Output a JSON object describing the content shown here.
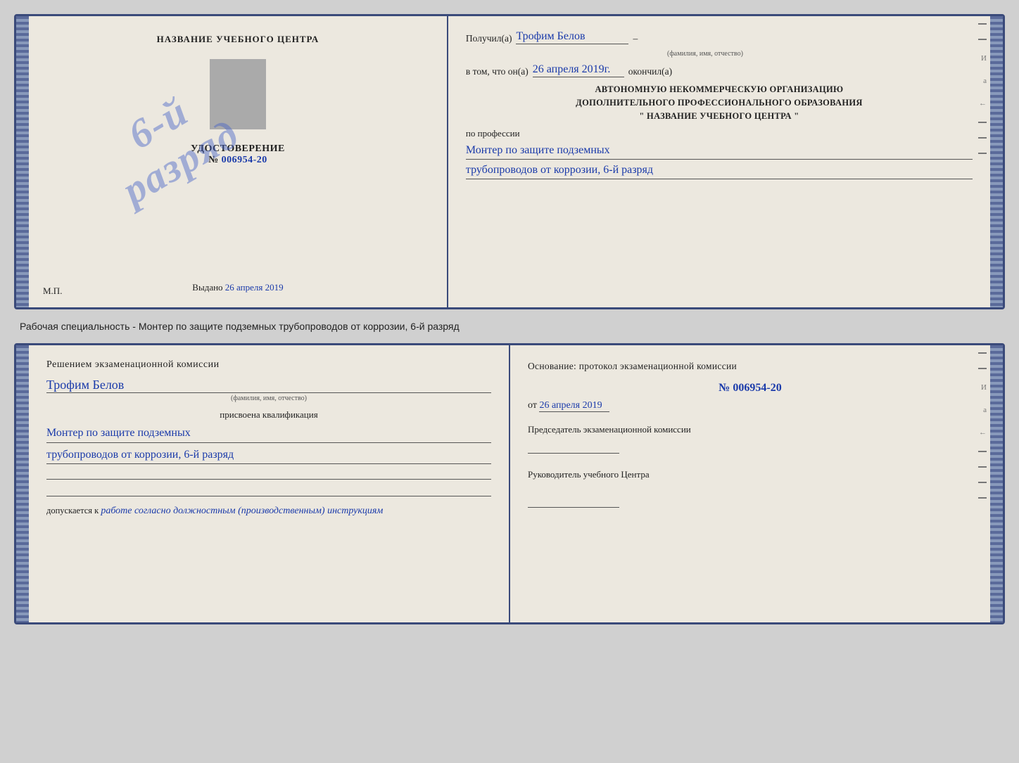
{
  "page": {
    "background": "#d0d0d0"
  },
  "top_cert": {
    "left": {
      "title": "НАЗВАНИЕ УЧЕБНОГО ЦЕНТРА",
      "stamp_line1": "6-й",
      "stamp_line2": "разряд",
      "subtitle": "УДОСТОВЕРЕНИЕ",
      "number_label": "№",
      "number_value": "006954-20",
      "issued_label": "Выдано",
      "issued_date": "26 апреля 2019",
      "mp_label": "М.П."
    },
    "right": {
      "received_label": "Получил(а)",
      "received_name": "Трофим Белов",
      "name_sublabel": "(фамилия, имя, отчество)",
      "dash1": "–",
      "in_that_label": "в том, что он(а)",
      "completed_date": "26 апреля 2019г.",
      "completed_label": "окончил(а)",
      "org_line1": "АВТОНОМНУЮ НЕКОММЕРЧЕСКУЮ ОРГАНИЗАЦИЮ",
      "org_line2": "ДОПОЛНИТЕЛЬНОГО ПРОФЕССИОНАЛЬНОГО ОБРАЗОВАНИЯ",
      "org_line3": "\"   НАЗВАНИЕ УЧЕБНОГО ЦЕНТРА   \"",
      "profession_label": "по профессии",
      "profession_line1": "Монтер по защите подземных",
      "profession_line2": "трубопроводов от коррозии, 6-й разряд"
    }
  },
  "specialty_text": "Рабочая специальность - Монтер по защите подземных трубопроводов от коррозии, 6-й разряд",
  "bottom_cert": {
    "left": {
      "title": "Решением экзаменационной комиссии",
      "name": "Трофим Белов",
      "name_sublabel": "(фамилия, имя, отчество)",
      "qual_assigned_label": "присвоена квалификация",
      "qual_line1": "Монтер по защите подземных",
      "qual_line2": "трубопроводов от коррозии, 6-й разряд",
      "admission_prefix": "допускается к",
      "admission_value": "работе согласно должностным (производственным) инструкциям"
    },
    "right": {
      "basis_label": "Основание: протокол экзаменационной комиссии",
      "protocol_number": "№ 006954-20",
      "date_prefix": "от",
      "date_value": "26 апреля 2019",
      "chairman_label": "Председатель экзаменационной комиссии",
      "head_label": "Руководитель учебного Центра"
    }
  }
}
